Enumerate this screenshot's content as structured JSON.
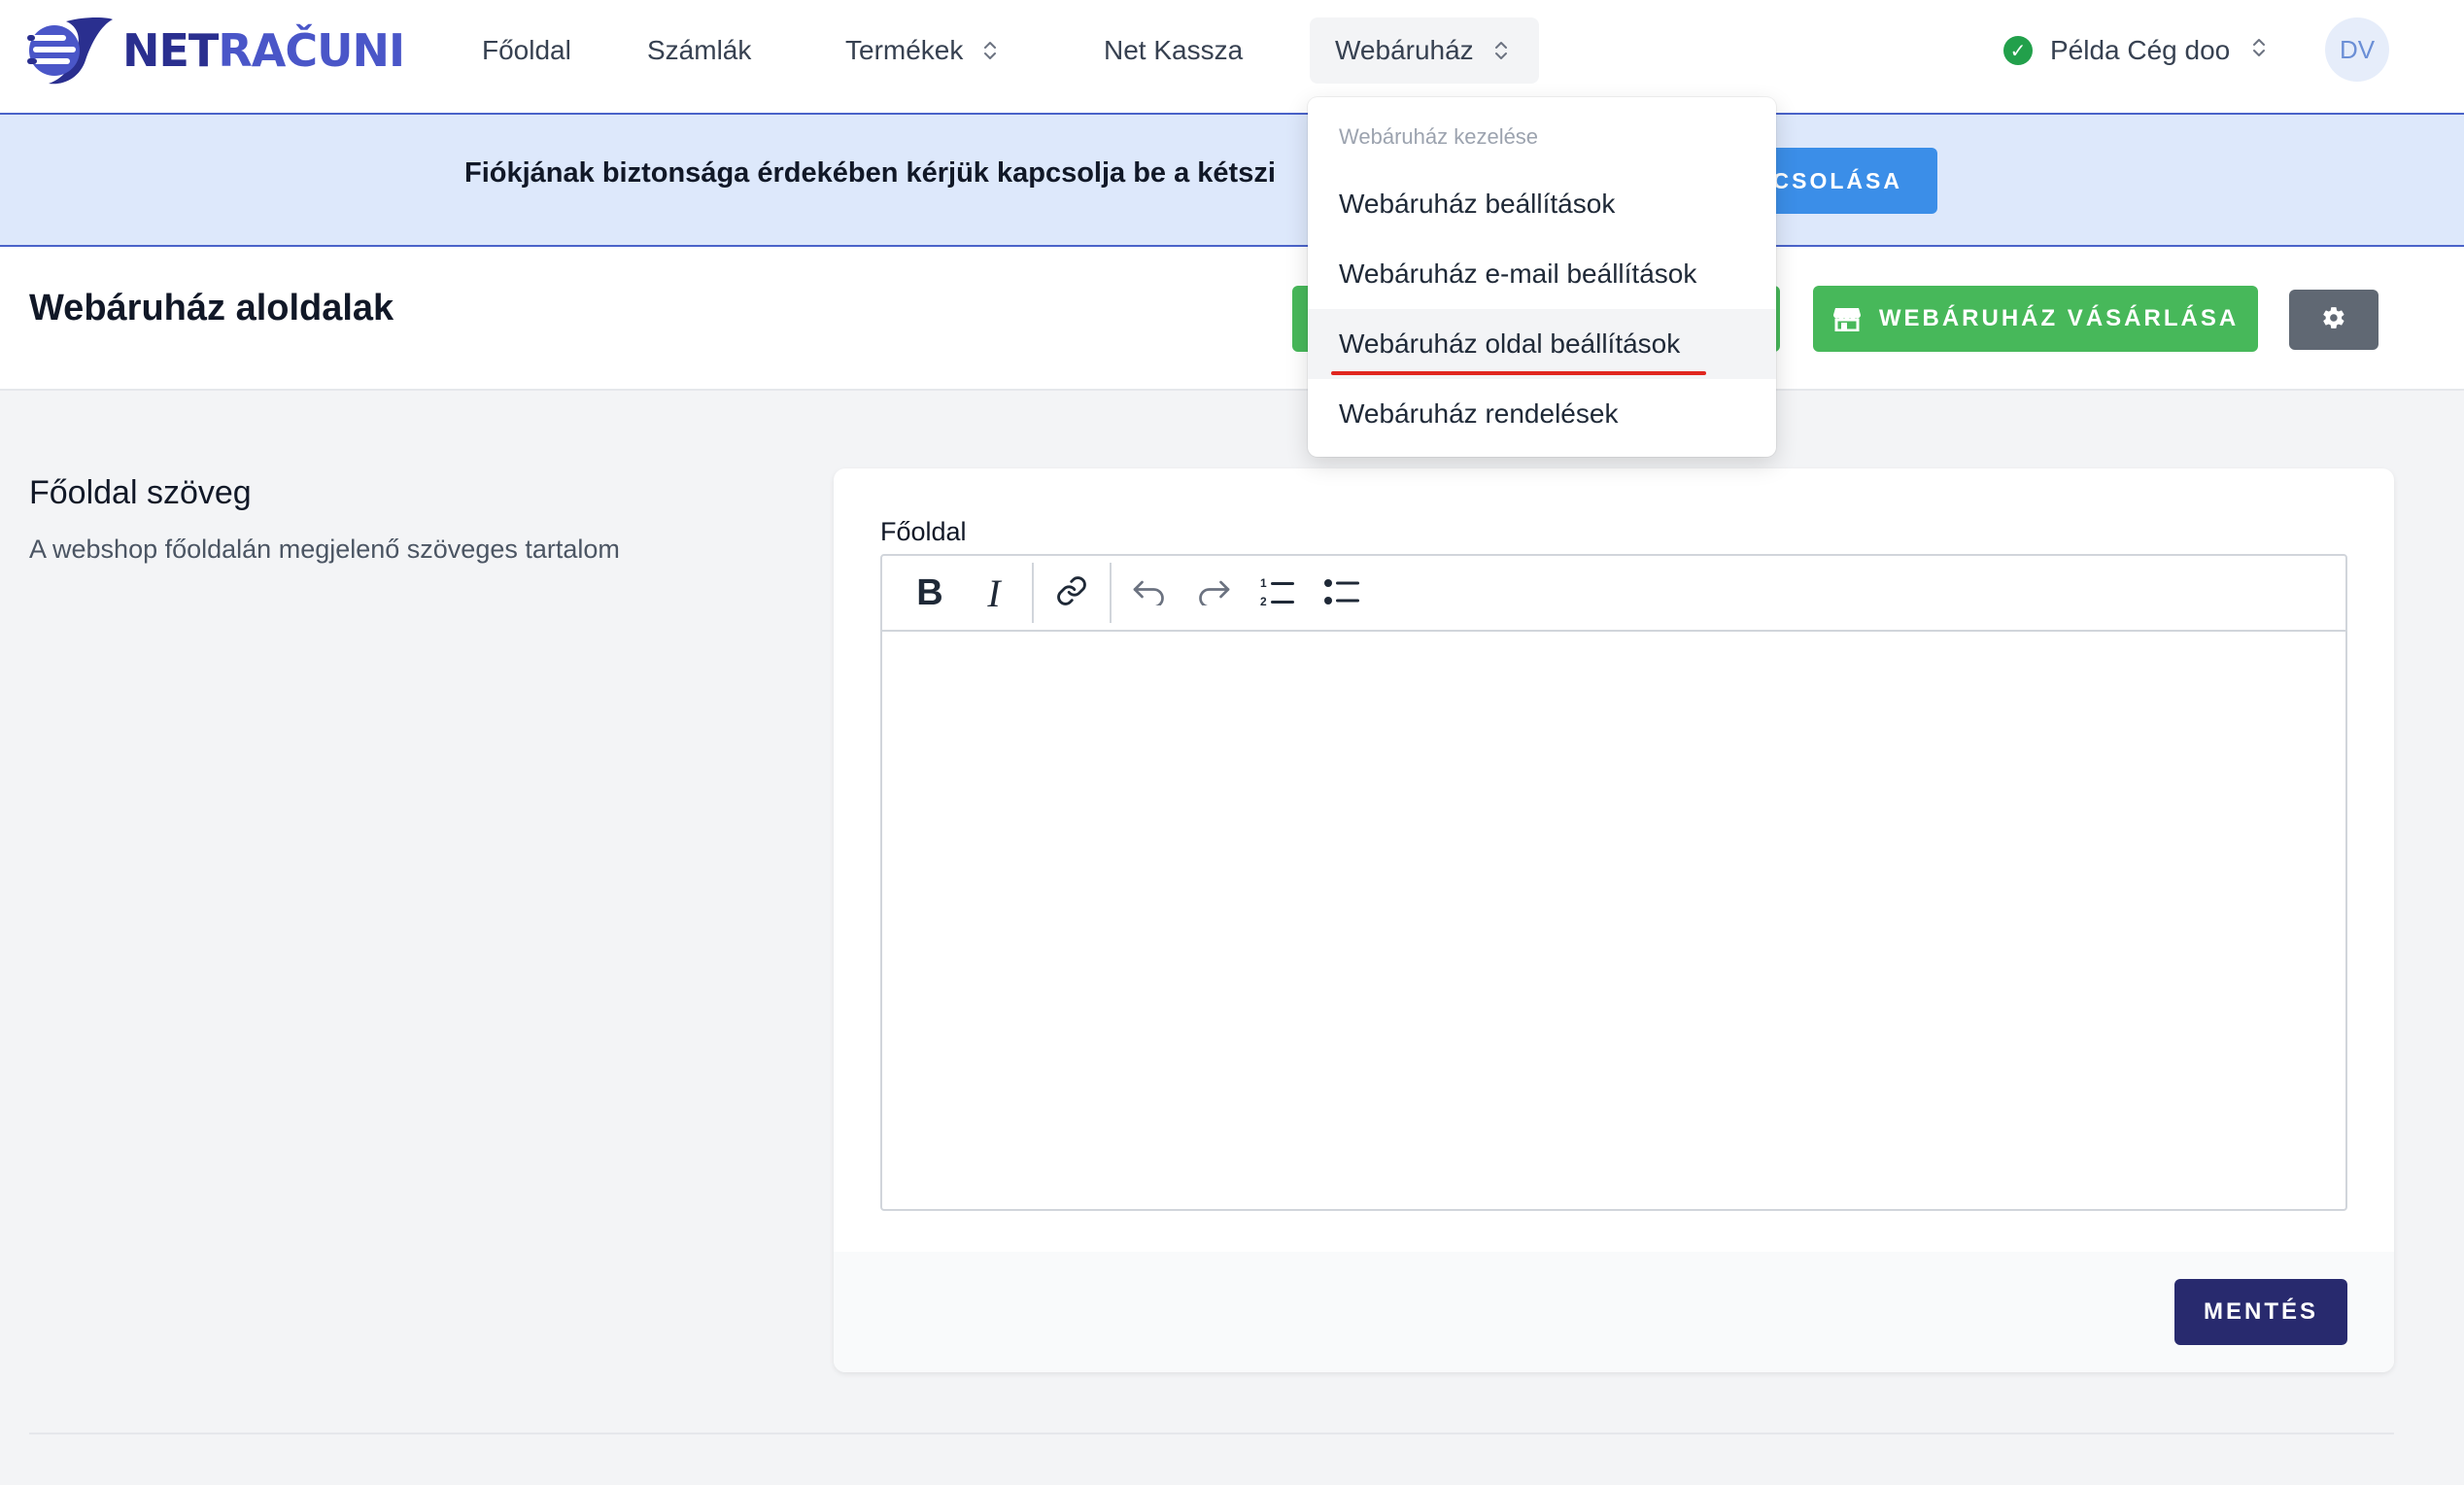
{
  "brand": {
    "part1": "NET",
    "part2": "RAČUNI"
  },
  "nav": {
    "items": [
      {
        "label": "Főoldal"
      },
      {
        "label": "Számlák"
      },
      {
        "label": "Termékek"
      },
      {
        "label": "Net Kassza"
      },
      {
        "label": "Webáruház"
      }
    ],
    "company": "Példa Cég doo",
    "avatar_initials": "DV"
  },
  "banner": {
    "text": "Fiókjának biztonsága érdekében kérjük kapcsolja be a kétszi",
    "button_label": "CSOLÁSA"
  },
  "page": {
    "title": "Webáruház aloldalak",
    "buy_button_label": "WEBÁRUHÁZ VÁSÁRLÁSA"
  },
  "section": {
    "title": "Főoldal szöveg",
    "description": "A webshop főoldalán megjelenő szöveges tartalom"
  },
  "editor": {
    "label": "Főoldal",
    "content": ""
  },
  "footer": {
    "save_label": "MENTÉS"
  },
  "dropdown": {
    "header": "Webáruház kezelése",
    "items": [
      {
        "label": "Webáruház beállítások"
      },
      {
        "label": "Webáruház e-mail beállítások"
      },
      {
        "label": "Webáruház oldal beállítások"
      },
      {
        "label": "Webáruház rendelések"
      }
    ]
  },
  "colors": {
    "brand_dark": "#2a2f8f",
    "brand_light": "#4a56c8",
    "green": "#47b85a",
    "save_button": "#282a6e",
    "banner_bg": "#dde8fb",
    "banner_button": "#3b8ee8",
    "highlight_underline": "#e0261f"
  }
}
